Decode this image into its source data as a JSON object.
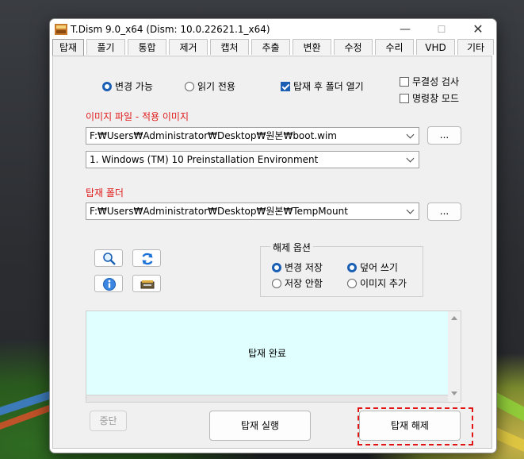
{
  "window": {
    "title": "T.Dism 9.0_x64  (Dism: 10.0.22621.1_x64)",
    "minimize_glyph": "—",
    "maximize_glyph": "☐",
    "close_glyph": "✕"
  },
  "tabs": [
    "탑재",
    "풀기",
    "통합",
    "제거",
    "캡처",
    "추출",
    "변환",
    "수정",
    "수리",
    "VHD",
    "기타"
  ],
  "active_tab": "탑재",
  "mode": {
    "change_enable": "변경 가능",
    "read_only": "읽기 전용",
    "open_folder_after_mount": "탑재 후 폴더 열기",
    "integrity_check": "무결성 검사",
    "cmd_mode": "명령창 모드"
  },
  "image": {
    "label": "이미지 파일 - 적용 이미지",
    "path": "F:₩Users₩Administrator₩Desktop₩원본₩boot.wim",
    "browse": "...",
    "index_value": "1. Windows (TM) 10 Preinstallation Environment"
  },
  "mount": {
    "label": "탑재 폴더",
    "path": "F:₩Users₩Administrator₩Desktop₩원본₩TempMount",
    "browse": "..."
  },
  "unmount_options": {
    "title": "해제 옵션",
    "save_changes": "변경 저장",
    "discard": "저장 안함",
    "overwrite": "덮어 쓰기",
    "append_image": "이미지 추가"
  },
  "log": {
    "text": "탑재 완료"
  },
  "buttons": {
    "stop": "중단",
    "mount": "탑재 실행",
    "unmount": "탑재 해제"
  },
  "icons": [
    "search-icon",
    "refresh-icon",
    "info-icon",
    "drive-icon"
  ],
  "colors": {
    "accent": "#1a5fb4",
    "label_red": "#e01b1b",
    "log_bg": "#e0ffff",
    "highlight": "#e31414"
  }
}
